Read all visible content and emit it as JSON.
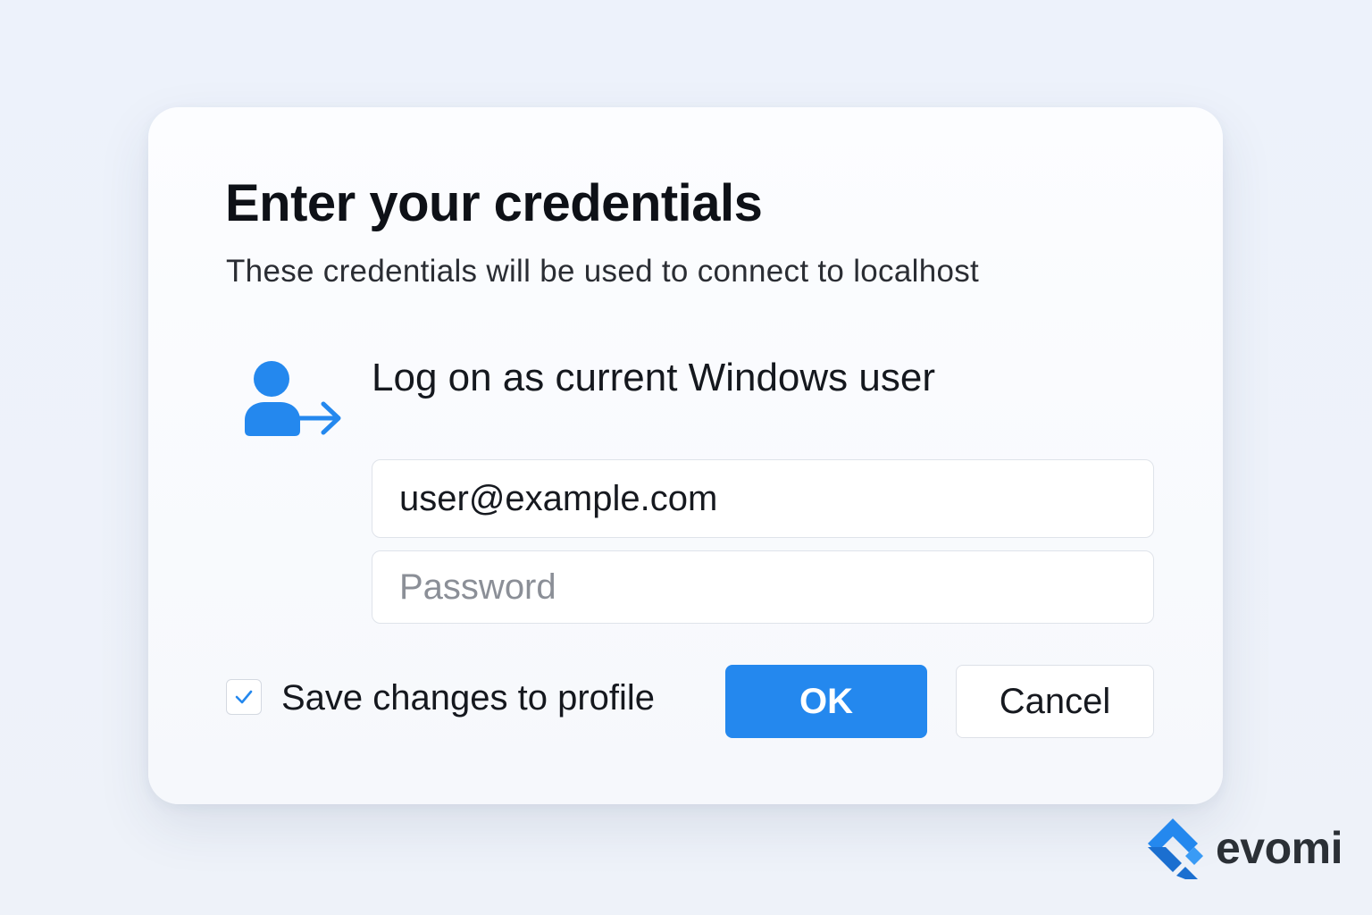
{
  "dialog": {
    "title": "Enter your credentials",
    "subtitle": "These credentials will be used to connect to localhost",
    "user_option": {
      "icon": "user-arrow-icon",
      "label": "Log on as current Windows user"
    },
    "username_field": {
      "value": "user@example.com"
    },
    "password_field": {
      "placeholder": "Password",
      "value": ""
    },
    "save_checkbox": {
      "label": "Save changes to profile",
      "checked": true
    },
    "buttons": {
      "ok_label": "OK",
      "cancel_label": "Cancel"
    }
  },
  "brand": {
    "name": "evomi",
    "logo_icon": "evomi-logo-icon"
  },
  "colors": {
    "accent": "#2488ee",
    "background": "#edf2fb",
    "dialog": "#fafbfe",
    "text": "#111318",
    "placeholder": "#8b8f97"
  }
}
